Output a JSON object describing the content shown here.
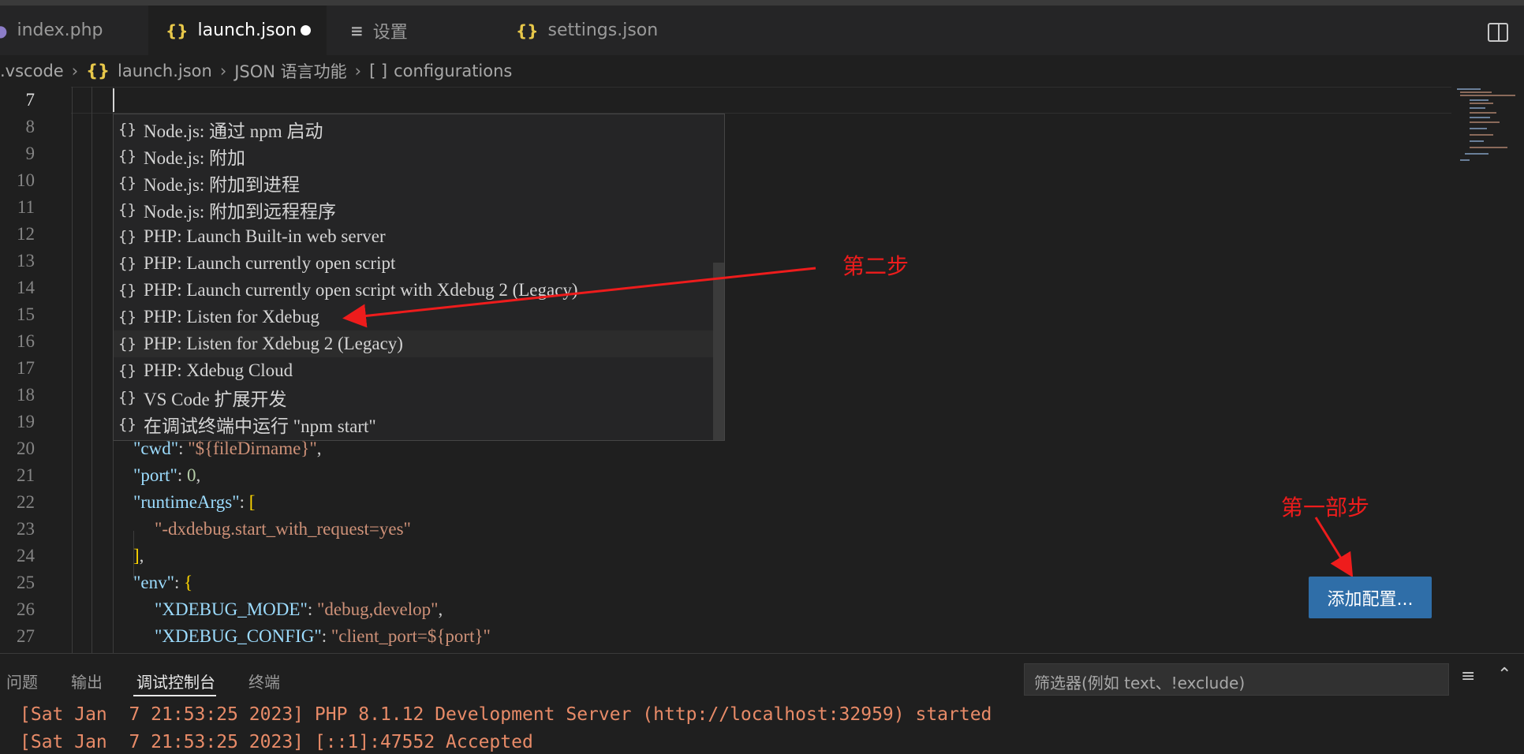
{
  "tabs": [
    {
      "label": "index.php",
      "icon": "php-elephant-icon"
    },
    {
      "label": "launch.json",
      "icon": "json-braces-icon",
      "active": true,
      "modified": true
    },
    {
      "label": "设置",
      "icon": "settings-lines-icon"
    },
    {
      "label": "settings.json",
      "icon": "json-braces-icon"
    }
  ],
  "breadcrumb": {
    "folder": ".vscode",
    "file_icon": "{}",
    "file": "launch.json",
    "section": "JSON 语言功能",
    "array_icon": "[ ]",
    "array": "configurations"
  },
  "editor": {
    "line_numbers": [
      "7",
      "8",
      "9",
      "10",
      "11",
      "12",
      "13",
      "14",
      "15",
      "16",
      "17",
      "18",
      "19",
      "20",
      "21",
      "22",
      "23",
      "24",
      "25",
      "26",
      "27"
    ],
    "visible_code": {
      "cwd_key": "\"cwd\"",
      "cwd_val": "\"${fileDirname}\"",
      "port_key": "\"port\"",
      "port_val": "0",
      "runtimeargs_key": "\"runtimeArgs\"",
      "runtimeargs_item": "\"-dxdebug.start_with_request=yes\"",
      "env_key": "\"env\"",
      "xdebug_mode_key": "\"XDEBUG_MODE\"",
      "xdebug_mode_val": "\"debug,develop\"",
      "xdebug_config_key": "\"XDEBUG_CONFIG\"",
      "xdebug_config_val": "\"client_port=${port}\""
    }
  },
  "suggestions": [
    "Node.js: 通过 npm 启动",
    "Node.js: 附加",
    "Node.js: 附加到进程",
    "Node.js: 附加到远程程序",
    "PHP: Launch Built-in web server",
    "PHP: Launch currently open script",
    "PHP: Launch currently open script with Xdebug 2 (Legacy)",
    "PHP: Listen for Xdebug",
    "PHP: Listen for Xdebug 2 (Legacy)",
    "PHP: Xdebug Cloud",
    "VS Code 扩展开发",
    "在调试终端中运行 \"npm start\""
  ],
  "suggestion_icon": "{}",
  "annotations": {
    "step2": "第二步",
    "step1": "第一部步",
    "arrow_color": "#ee1c1c"
  },
  "add_config_button": "添加配置...",
  "panel": {
    "tabs": [
      "问题",
      "输出",
      "调试控制台",
      "终端"
    ],
    "active_tab": "调试控制台",
    "filter_placeholder": "筛选器(例如 text、!exclude)",
    "output_lines": [
      "[Sat Jan  7 21:53:25 2023] PHP 8.1.12 Development Server (http://localhost:32959) started",
      "[Sat Jan  7 21:53:25 2023] [::1]:47552 Accepted"
    ]
  },
  "colors": {
    "background": "#1f1f1f",
    "accent_button": "#2f6ea8",
    "annotation": "#ee1c1c",
    "string": "#ce9178",
    "key": "#9cdcfe",
    "number": "#b5cea8"
  }
}
